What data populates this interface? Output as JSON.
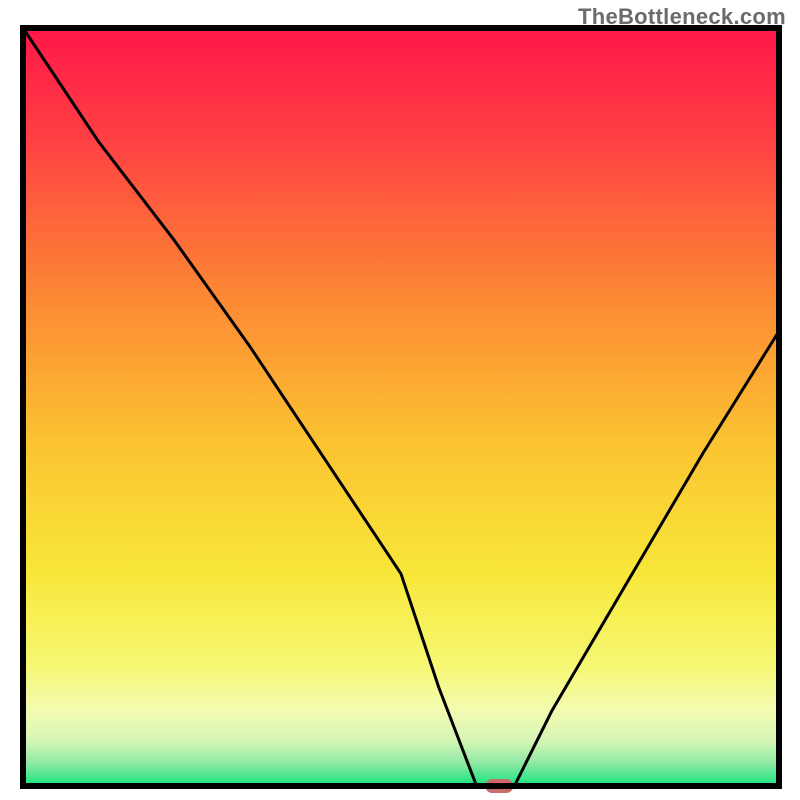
{
  "watermark": "TheBottleneck.com",
  "chart_data": {
    "type": "line",
    "title": "",
    "xlabel": "",
    "ylabel": "",
    "xlim": [
      0,
      100
    ],
    "ylim": [
      0,
      100
    ],
    "grid": false,
    "legend": false,
    "series": [
      {
        "name": "bottleneck-curve",
        "x": [
          0,
          10,
          20,
          30,
          40,
          50,
          55,
          60,
          62,
          65,
          70,
          80,
          90,
          100
        ],
        "y": [
          100,
          85,
          72,
          58,
          43,
          28,
          13,
          0,
          0,
          0,
          10,
          27,
          44,
          60
        ]
      }
    ],
    "marker": {
      "name": "optimal-point",
      "x": 63,
      "y": 0,
      "color": "#cb6a6a"
    },
    "background_gradient": {
      "stops": [
        {
          "pos": 0.0,
          "color": "#ff1749"
        },
        {
          "pos": 0.15,
          "color": "#ff4143"
        },
        {
          "pos": 0.35,
          "color": "#fc8734"
        },
        {
          "pos": 0.55,
          "color": "#fbc431"
        },
        {
          "pos": 0.72,
          "color": "#f8e73a"
        },
        {
          "pos": 0.84,
          "color": "#f6f873"
        },
        {
          "pos": 0.9,
          "color": "#f3fbb0"
        },
        {
          "pos": 0.94,
          "color": "#d6f6b6"
        },
        {
          "pos": 0.97,
          "color": "#8de9a3"
        },
        {
          "pos": 1.0,
          "color": "#16e47e"
        }
      ]
    },
    "frame_color": "#000000",
    "curve_color": "#000000"
  }
}
